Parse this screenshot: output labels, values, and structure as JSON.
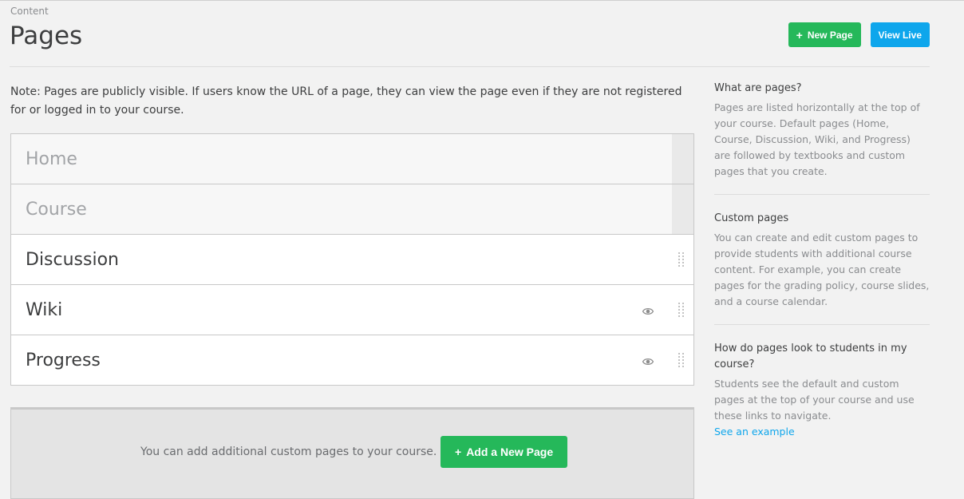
{
  "header": {
    "subtitle": "Content",
    "title": "Pages",
    "new_page_label": "New Page",
    "view_live_label": "View Live"
  },
  "note": "Note: Pages are publicly visible. If users know the URL of a page, they can view the page even if they are not registered for or logged in to your course.",
  "pages": [
    {
      "name": "Home",
      "fixed": true,
      "eye": false
    },
    {
      "name": "Course",
      "fixed": true,
      "eye": false
    },
    {
      "name": "Discussion",
      "fixed": false,
      "eye": false
    },
    {
      "name": "Wiki",
      "fixed": false,
      "eye": true
    },
    {
      "name": "Progress",
      "fixed": false,
      "eye": true
    }
  ],
  "add_section": {
    "text": "You can add additional custom pages to your course.",
    "button_label": "Add a New Page"
  },
  "sidebar": {
    "sections": [
      {
        "title": "What are pages?",
        "body": "Pages are listed horizontally at the top of your course. Default pages (Home, Course, Discussion, Wiki, and Progress) are followed by textbooks and custom pages that you create."
      },
      {
        "title": "Custom pages",
        "body": "You can create and edit custom pages to provide students with additional course content. For example, you can create pages for the grading policy, course slides, and a course calendar."
      },
      {
        "title": "How do pages look to students in my course?",
        "body": "Students see the default and custom pages at the top of your course and use these links to navigate.",
        "link": "See an example"
      }
    ]
  },
  "colors": {
    "green": "#25b85a",
    "blue": "#0ea6ec",
    "background": "#f2f2f2"
  }
}
